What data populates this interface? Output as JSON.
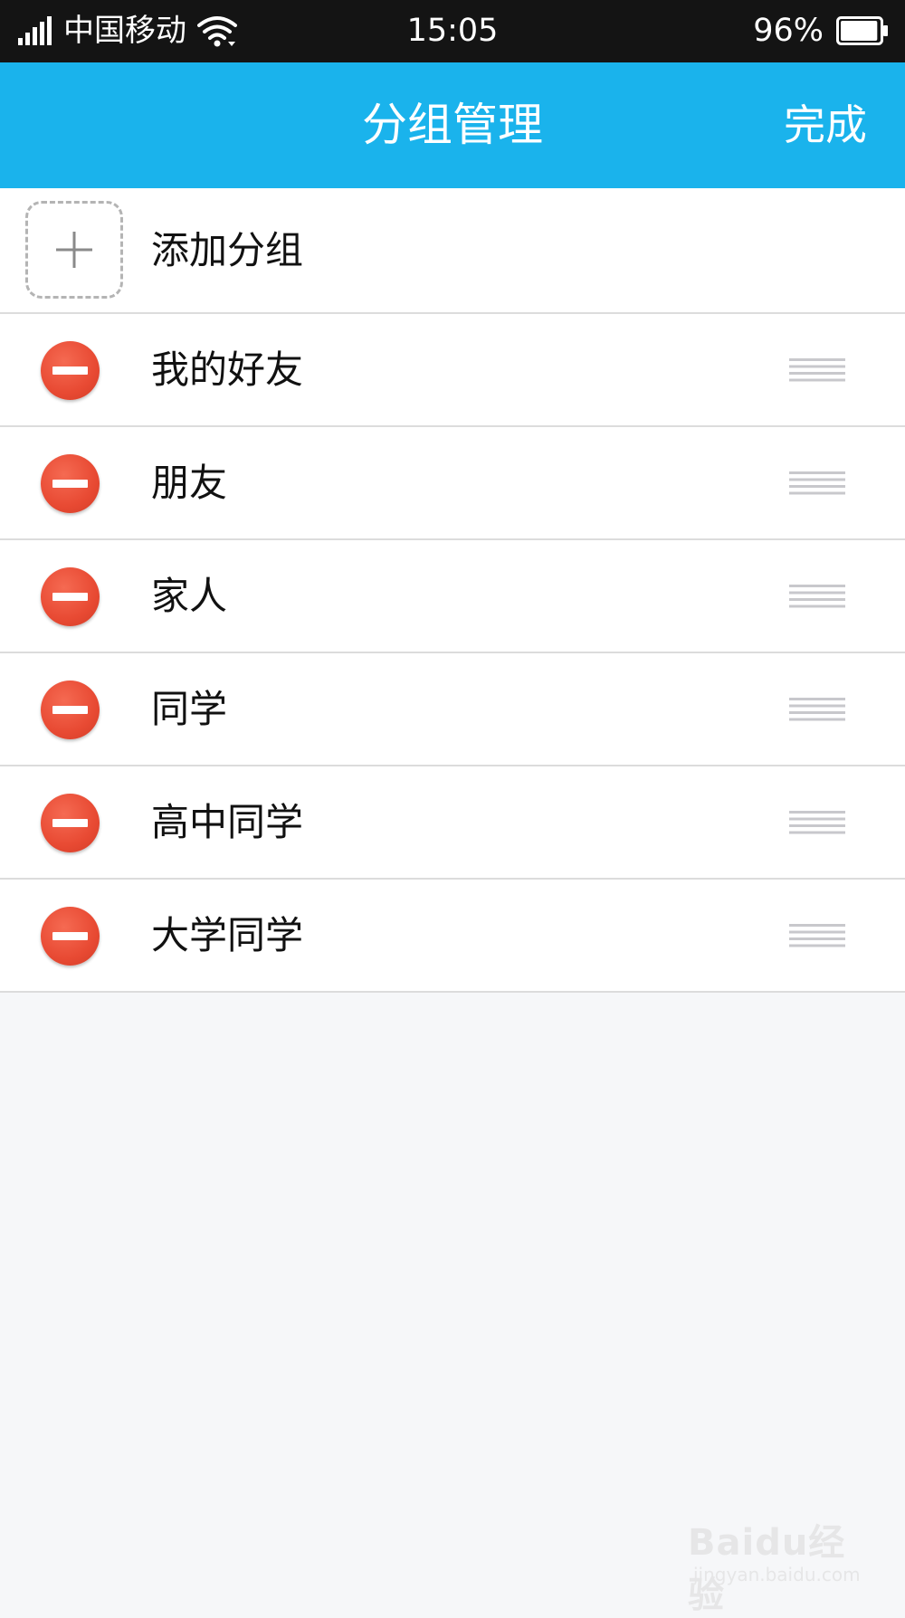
{
  "status_bar": {
    "carrier": "中国移动",
    "time": "15:05",
    "battery_percent": "96%",
    "battery_level": 0.96,
    "signal_icon": "signal-bars-icon",
    "wifi_icon": "wifi-icon",
    "battery_icon": "battery-icon"
  },
  "nav": {
    "title": "分组管理",
    "done_label": "完成"
  },
  "add_group": {
    "label": "添加分组",
    "icon": "plus-icon"
  },
  "groups": [
    {
      "name": "我的好友"
    },
    {
      "name": "朋友"
    },
    {
      "name": "家人"
    },
    {
      "name": "同学"
    },
    {
      "name": "高中同学"
    },
    {
      "name": "大学同学"
    }
  ],
  "watermark": {
    "brand": "Baidu经验",
    "url": "jingyan.baidu.com"
  },
  "colors": {
    "status_bar_bg": "#141414",
    "nav_bg": "#1ab3ec",
    "delete_red": "#e84a33",
    "page_bg": "#f6f7f9",
    "divider": "#dcdcdc"
  }
}
